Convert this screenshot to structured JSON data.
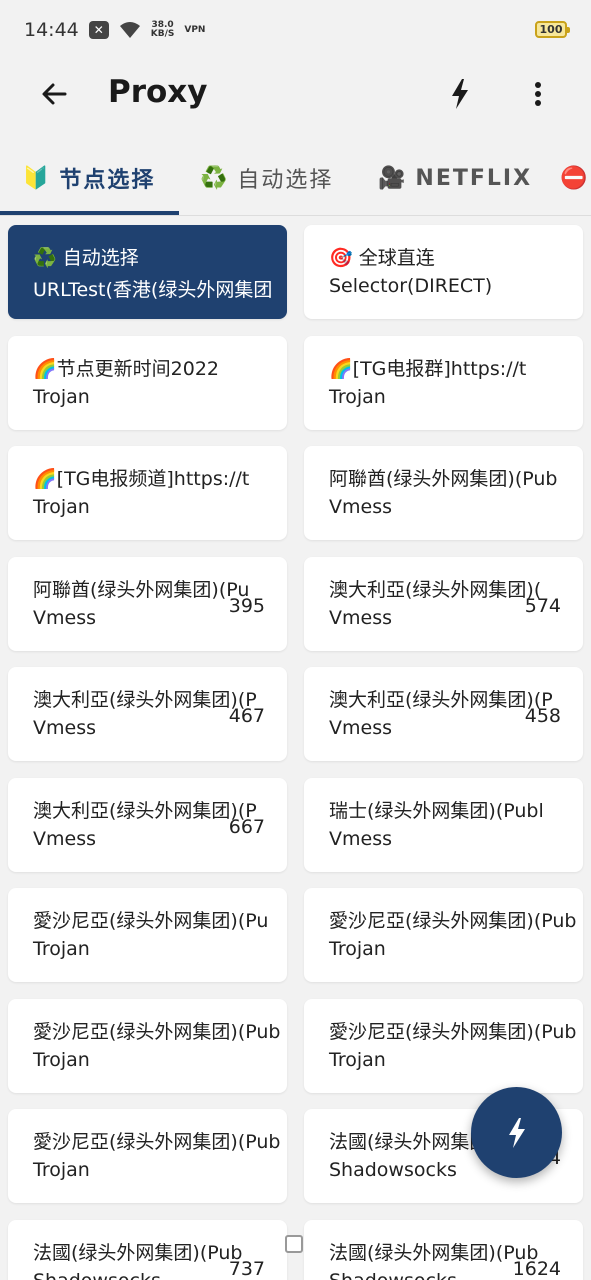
{
  "status_bar": {
    "time": "14:44",
    "net_speed_value": "38.0",
    "net_speed_unit": "KB/S",
    "vpn_label": "VPN",
    "battery_level": "100"
  },
  "app_bar": {
    "title": "Proxy"
  },
  "tabs": [
    {
      "emoji": "🔰",
      "label": "节点选择",
      "active": true
    },
    {
      "emoji": "♻️",
      "label": "自动选择",
      "active": false
    },
    {
      "emoji": "🎥",
      "label": "NETFLIX",
      "active": false
    },
    {
      "emoji": "⛔",
      "label": "",
      "active": false
    }
  ],
  "proxies": [
    {
      "name": "♻️ 自动选择",
      "type": "URLTest(香港(绿头外网集团",
      "delay": "",
      "selected": true
    },
    {
      "name": "🎯 全球直连",
      "type": "Selector(DIRECT)",
      "delay": "",
      "selected": false
    },
    {
      "name": "🌈节点更新时间2022",
      "type": "Trojan",
      "delay": "",
      "selected": false
    },
    {
      "name": "🌈[TG电报群]https://t",
      "type": "Trojan",
      "delay": "",
      "selected": false
    },
    {
      "name": "🌈[TG电报频道]https://t",
      "type": "Trojan",
      "delay": "",
      "selected": false
    },
    {
      "name": "阿聯酋(绿头外网集团)(Pub",
      "type": "Vmess",
      "delay": "",
      "selected": false
    },
    {
      "name": "阿聯酋(绿头外网集团)(Pu",
      "type": "Vmess",
      "delay": "395",
      "selected": false
    },
    {
      "name": "澳大利亞(绿头外网集团)(",
      "type": "Vmess",
      "delay": "574",
      "selected": false
    },
    {
      "name": "澳大利亞(绿头外网集团)(P",
      "type": "Vmess",
      "delay": "467",
      "selected": false
    },
    {
      "name": "澳大利亞(绿头外网集团)(P",
      "type": "Vmess",
      "delay": "458",
      "selected": false
    },
    {
      "name": "澳大利亞(绿头外网集团)(P",
      "type": "Vmess",
      "delay": "667",
      "selected": false
    },
    {
      "name": "瑞士(绿头外网集团)(Publ",
      "type": "Vmess",
      "delay": "",
      "selected": false
    },
    {
      "name": "愛沙尼亞(绿头外网集团)(Pu",
      "type": "Trojan",
      "delay": "",
      "selected": false
    },
    {
      "name": "愛沙尼亞(绿头外网集团)(Pub",
      "type": "Trojan",
      "delay": "",
      "selected": false
    },
    {
      "name": "愛沙尼亞(绿头外网集团)(Pub",
      "type": "Trojan",
      "delay": "",
      "selected": false
    },
    {
      "name": "愛沙尼亞(绿头外网集团)(Pub",
      "type": "Trojan",
      "delay": "",
      "selected": false
    },
    {
      "name": "愛沙尼亞(绿头外网集团)(Pub",
      "type": "Trojan",
      "delay": "",
      "selected": false
    },
    {
      "name": "法國(绿头外网集团)(Pub",
      "type": "Shadowsocks",
      "delay": "4",
      "selected": false
    },
    {
      "name": "法國(绿头外网集团)(Pub",
      "type": "Shadowsocks",
      "delay": "737",
      "selected": false
    },
    {
      "name": "法國(绿头外网集团)(Pub",
      "type": "Shadowsocks",
      "delay": "1624",
      "selected": false
    }
  ],
  "colors": {
    "accent": "#1f4170",
    "background": "#f2f2f2",
    "card": "#ffffff"
  },
  "icons": {
    "back": "arrow-left-icon",
    "test": "lightning-bolt-icon",
    "more": "more-vertical-icon",
    "fab": "lightning-bolt-icon"
  }
}
